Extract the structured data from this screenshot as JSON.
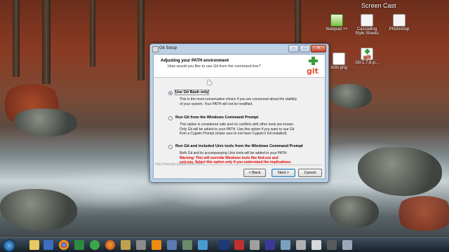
{
  "desktop": {
    "screen_cast_label": "Screen Cast",
    "icons": [
      {
        "label": "Notepad ++",
        "icon": "notepad-plus-plus-icon"
      },
      {
        "label": "Cascading Style Sheets",
        "icon": "css-file-icon"
      },
      {
        "label": "Photoshop",
        "icon": "photoshop-icon"
      },
      {
        "label": "todo.png",
        "icon": "png-file-icon"
      },
      {
        "label": "Git-1.7.6-p...",
        "icon": "git-installer-icon"
      }
    ]
  },
  "dialog": {
    "title": "Git Setup",
    "header_title": "Adjusting your PATH environment",
    "header_subtitle": "How would you like to use Git from the command line?",
    "options": [
      {
        "label": "Use Git Bash only",
        "selected": true,
        "description": [
          "This is the most conservative choice if you are concerned about the stability",
          "of your system. Your PATH will not be modified."
        ]
      },
      {
        "label": "Run Git from the Windows Command Prompt",
        "selected": false,
        "description": [
          "This option is considered safe and no conflicts with other tools are known.",
          "Only Git will be added to your PATH. Use this option if you want to use Git",
          "from a Cygwin Prompt (make sure to not have Cygwin's Git installed)."
        ]
      },
      {
        "label": "Run Git and included Unix tools from the Windows Command Prompt",
        "selected": false,
        "description": [
          "Both Git and its accompanying Unix tools will be added to your PATH."
        ],
        "warning": [
          "Warning: This will override Windows tools like find.exe and",
          "sort.exe. Select this option only if you understand the implications."
        ]
      }
    ],
    "footer_url": "http://msysgit.googlecode.com/",
    "buttons": {
      "back": "< Back",
      "next": "Next >",
      "cancel": "Cancel"
    },
    "window_controls": {
      "minimize": "–",
      "maximize": "□",
      "close": "✕"
    }
  },
  "colors": {
    "warning": "#e00000",
    "accent": "#3c7fb1",
    "git_red": "#e44c2e",
    "git_green": "#3b9e3b"
  }
}
